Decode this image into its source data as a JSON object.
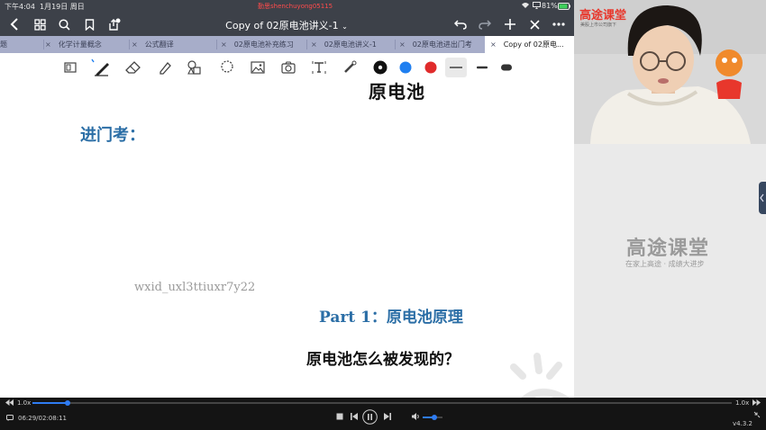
{
  "status_bar": {
    "time": "下午4:04",
    "date": "1月19日 周日",
    "center_watermark": "勤思shenchuyong05115",
    "battery": "81%"
  },
  "nav": {
    "doc_title": "Copy of 02原电池讲义-1"
  },
  "tabs": [
    {
      "label": "题"
    },
    {
      "label": "化学计量概念"
    },
    {
      "label": "公式翻译"
    },
    {
      "label": "02原电池补充练习"
    },
    {
      "label": "02原电池讲义-1"
    },
    {
      "label": "02原电池进出门考"
    },
    {
      "label": "Copy of 02原电..."
    }
  ],
  "page": {
    "heading": "原电池",
    "entry_label": "进门考：",
    "watermark": "wxid_uxl3ttiuxr7y22",
    "part_title": "Part 1：原电池原理",
    "question": "原电池怎么被发现的？"
  },
  "webcam": {
    "brand": "高途课堂",
    "brand_sub": "美股上市公司旗下"
  },
  "side_panel": {
    "brand": "高途课堂",
    "slogan": "在家上高途 · 成绩大进步"
  },
  "player": {
    "speed_left": "1.0x",
    "speed_right": "1.0x",
    "time": "06:29/02:08:11",
    "version": "v4.3.2",
    "progress": 0.05,
    "volume": 0.6
  },
  "colors": {
    "tab_bar": "#a7adc9",
    "nav_bar": "#3d4149",
    "accent_blue": "#2b6ea6",
    "pen_black": "#111111",
    "pen_blue": "#1f7ff0",
    "pen_red": "#e02b2b",
    "brand_red": "#e8372c"
  }
}
